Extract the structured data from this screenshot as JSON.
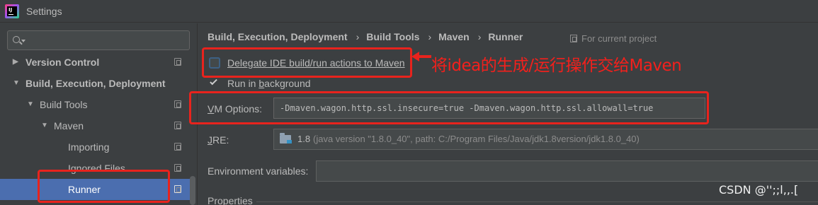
{
  "window": {
    "title": "Settings",
    "app_icon": "intellij-idea-icon",
    "app_icon_text": "IJ"
  },
  "sidebar": {
    "search": {
      "value": "",
      "placeholder": ""
    },
    "items": [
      {
        "label": "Version Control",
        "bold": true,
        "expanded": false
      },
      {
        "label": "Build, Execution, Deployment",
        "bold": true,
        "expanded": true
      },
      {
        "label": "Build Tools",
        "bold": false,
        "expanded": true
      },
      {
        "label": "Maven",
        "bold": false,
        "expanded": true
      },
      {
        "label": "Importing",
        "bold": false
      },
      {
        "label": "Ignored Files",
        "bold": false
      },
      {
        "label": "Runner",
        "bold": false,
        "selected": true
      }
    ]
  },
  "breadcrumb": [
    "Build, Execution, Deployment",
    "Build Tools",
    "Maven",
    "Runner"
  ],
  "scope_label": "For current project",
  "options": {
    "delegate": {
      "label": "Delegate IDE build/run actions to Maven",
      "checked": false
    },
    "background": {
      "label_prefix": "Run in ",
      "label_mnemonic": "b",
      "label_suffix": "ackground",
      "checked": true
    }
  },
  "vm_options": {
    "label_mnemonic": "V",
    "label_rest": "M Options:",
    "value": "-Dmaven.wagon.http.ssl.insecure=true -Dmaven.wagon.http.ssl.allowall=true"
  },
  "jre": {
    "label_mnemonic": "J",
    "label_rest": "RE:",
    "version": "1.8",
    "details": "(java version \"1.8.0_40\", path: C:/Program Files/Java/jdk1.8version/jdk1.8.0_40)"
  },
  "env": {
    "label": "Environment variables:",
    "value": ""
  },
  "properties_label": "Properties",
  "annotation": {
    "text": "将idea的生成/运行操作交给Maven",
    "color": "#e8231d"
  },
  "watermark": "CSDN @'';;l,,.[",
  "colors": {
    "background": "#3c3f41",
    "selection": "#4b6eaf",
    "annotation_red": "#e8231d"
  }
}
